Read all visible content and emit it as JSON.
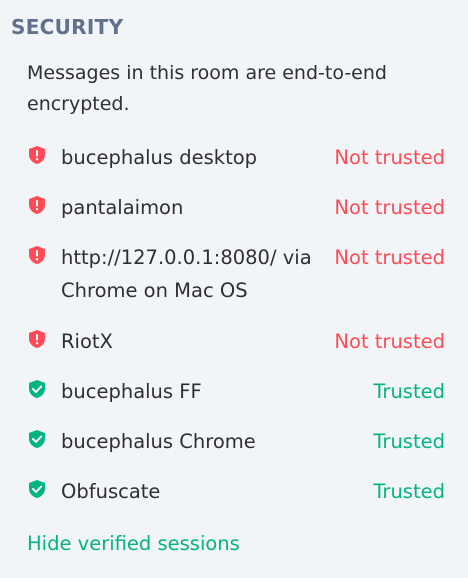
{
  "section": {
    "title": "SECURITY",
    "intro": "Messages in this room are end-to-end encrypted."
  },
  "sessions": [
    {
      "name": "bucephalus desktop",
      "status": "Not trusted",
      "trusted": false,
      "icon": "shield-warning-icon"
    },
    {
      "name": "pantalaimon",
      "status": "Not trusted",
      "trusted": false,
      "icon": "shield-warning-icon"
    },
    {
      "name": "http://127.0.0.1:8080/ via Chrome on Mac OS",
      "status": "Not trusted",
      "trusted": false,
      "icon": "shield-warning-icon"
    },
    {
      "name": "RiotX",
      "status": "Not trusted",
      "trusted": false,
      "icon": "shield-warning-icon"
    },
    {
      "name": "bucephalus FF",
      "status": "Trusted",
      "trusted": true,
      "icon": "shield-check-icon"
    },
    {
      "name": "bucephalus Chrome",
      "status": "Trusted",
      "trusted": true,
      "icon": "shield-check-icon"
    },
    {
      "name": "Obfuscate",
      "status": "Trusted",
      "trusted": true,
      "icon": "shield-check-icon"
    }
  ],
  "footer": {
    "hide_verified_label": "Hide verified sessions"
  },
  "colors": {
    "untrusted": "#ff4b55",
    "trusted": "#03b381",
    "heading": "#61708b",
    "background": "#f2f5f8"
  }
}
